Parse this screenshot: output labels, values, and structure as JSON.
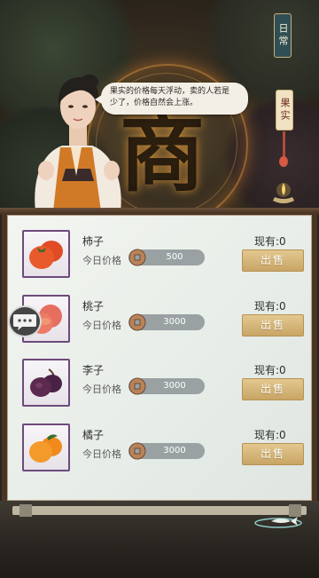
{
  "speech": {
    "line1": "果实的价格每天浮动，卖的人若是",
    "line2": "少了，价格自然会上涨。"
  },
  "side_tabs": {
    "day": "日常",
    "fruit": "果实"
  },
  "center_glyph": "商",
  "price_label": "今日价格",
  "sell_label": "出售",
  "stock_prefix": "现有:",
  "items": [
    {
      "name": "柿子",
      "price": "500",
      "stock": "0",
      "fruit_icon": "persimmon-icon",
      "color": "#e5562a"
    },
    {
      "name": "桃子",
      "price": "3000",
      "stock": "0",
      "fruit_icon": "peach-icon",
      "color": "#e66e5e"
    },
    {
      "name": "李子",
      "price": "3000",
      "stock": "0",
      "fruit_icon": "plum-icon",
      "color": "#5b2a4e"
    },
    {
      "name": "橘子",
      "price": "3000",
      "stock": "0",
      "fruit_icon": "orange-icon",
      "color": "#f08a1c"
    }
  ],
  "colors": {
    "sell_button": "#d7b87a",
    "panel_bg": "#eef2ee",
    "frame": "#4a3524"
  }
}
